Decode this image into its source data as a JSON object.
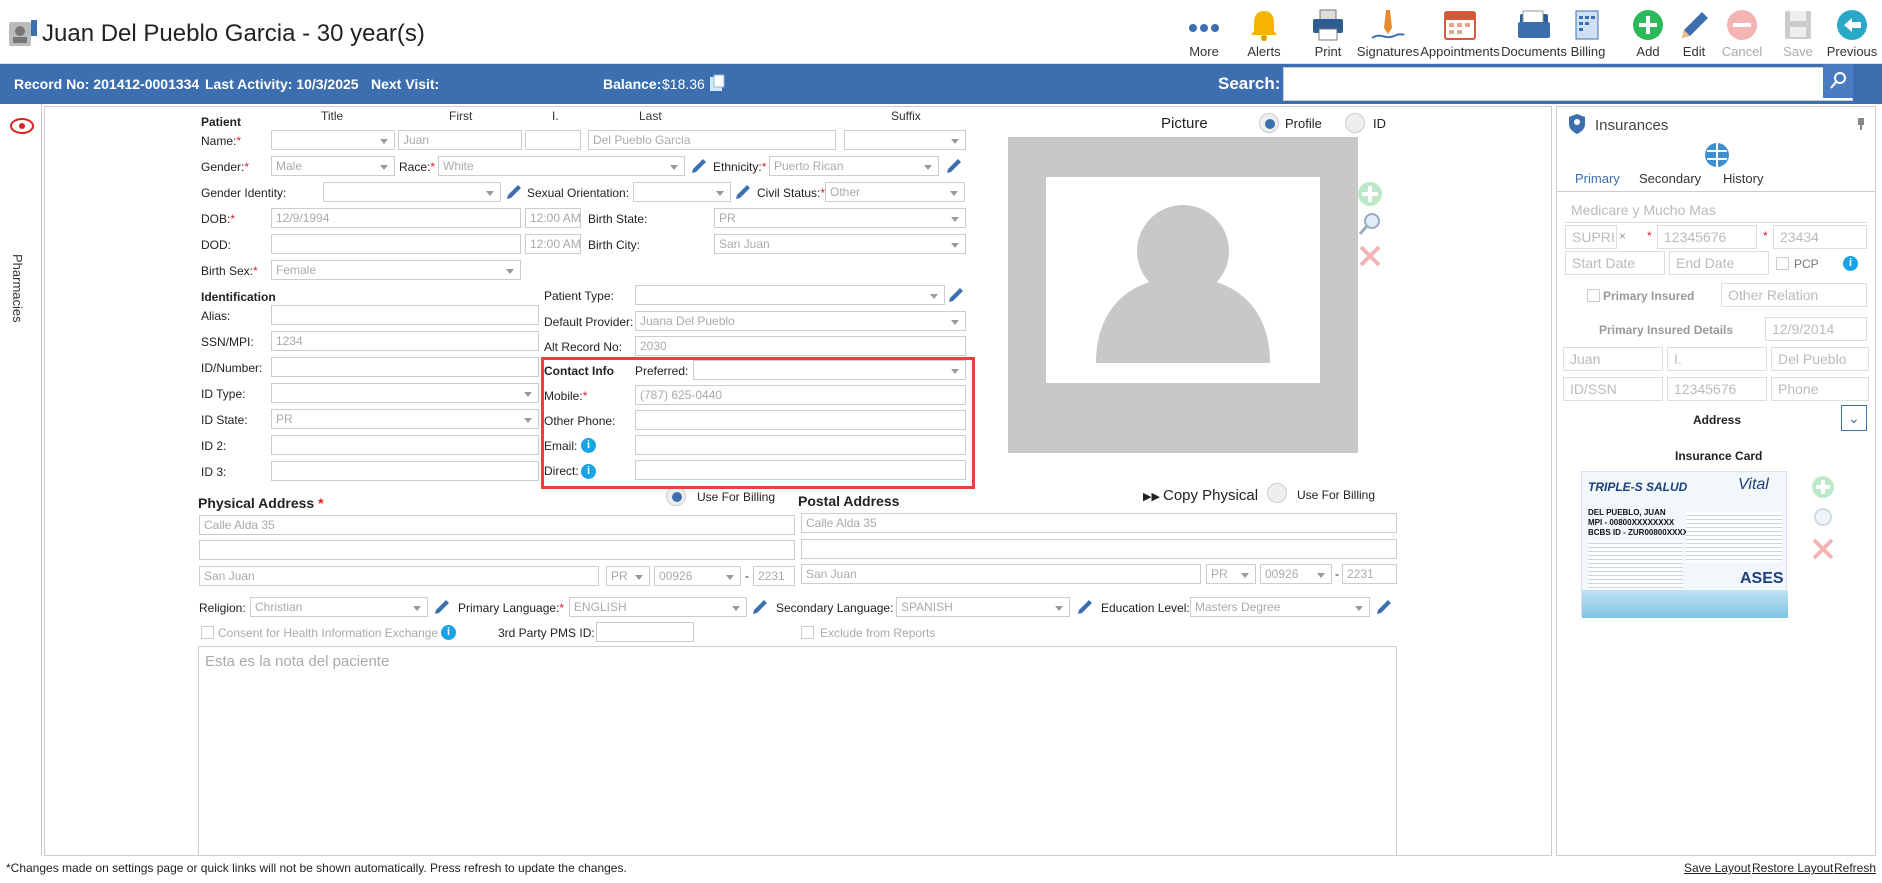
{
  "header": {
    "patient_title": "Juan Del Pueblo Garcia - 30 year(s)"
  },
  "toolbar": {
    "more": "More",
    "alerts": "Alerts",
    "print": "Print",
    "signatures": "Signatures",
    "appointments": "Appointments",
    "documents": "Documents",
    "billing": "Billing",
    "add": "Add",
    "edit": "Edit",
    "cancel": "Cancel",
    "save": "Save",
    "previous": "Previous"
  },
  "bluebar": {
    "record": "Record No: 201412-0001334",
    "last_activity": "Last Activity: 10/3/2025",
    "next_visit": "Next Visit:",
    "balance_label": "Balance:",
    "balance_value": "$18.36",
    "search_label": "Search:",
    "search_clear": "×"
  },
  "sidebar": {
    "pharmacies": "Pharmacies"
  },
  "patient": {
    "section": "Patient",
    "col_title": "Title",
    "col_first": "First",
    "col_i": "I.",
    "col_last": "Last",
    "col_suffix": "Suffix",
    "name_label": "Name:",
    "first": "Juan",
    "last": "Del Pueblo Garcia",
    "gender_label": "Gender:",
    "gender": "Male",
    "race_label": "Race:",
    "race": "White",
    "ethnicity_label": "Ethnicity:",
    "ethnicity": "Puerto Rican",
    "gender_identity_label": "Gender Identity:",
    "sexual_orientation_label": "Sexual Orientation:",
    "civil_status_label": "Civil Status:",
    "civil_status": "Other",
    "dob_label": "DOB:",
    "dob": "12/9/1994",
    "dob_time": "12:00 AM",
    "birth_state_label": "Birth State:",
    "birth_state": "PR",
    "dod_label": "DOD:",
    "dod_time": "12:00 AM",
    "birth_city_label": "Birth City:",
    "birth_city": "San Juan",
    "birth_sex_label": "Birth Sex:",
    "birth_sex": "Female"
  },
  "identification": {
    "section": "Identification",
    "alias_label": "Alias:",
    "ssn_label": "SSN/MPI:",
    "ssn": "1234",
    "id_number_label": "ID/Number:",
    "id_type_label": "ID Type:",
    "id_state_label": "ID State:",
    "id_state": "PR",
    "id2_label": "ID 2:",
    "id3_label": "ID 3:",
    "patient_type_label": "Patient Type:",
    "default_provider_label": "Default Provider:",
    "default_provider": "Juana Del Pueblo",
    "alt_record_label": "Alt Record No:",
    "alt_record": "2030"
  },
  "contact": {
    "section": "Contact Info",
    "preferred_label": "Preferred:",
    "mobile_label": "Mobile:",
    "mobile": "(787) 625-0440",
    "other_phone_label": "Other Phone:",
    "email_label": "Email:",
    "direct_label": "Direct:"
  },
  "picture": {
    "label": "Picture",
    "profile": "Profile",
    "id": "ID"
  },
  "physical": {
    "title": "Physical Address",
    "use_billing": "Use For Billing",
    "addr1": "Calle Alda 35",
    "city": "San Juan",
    "state": "PR",
    "zip": "00926",
    "zip4": "2231"
  },
  "postal": {
    "title": "Postal Address",
    "copy": "Copy Physical",
    "use_billing": "Use For Billing",
    "addr1": "Calle Alda 35",
    "city": "San Juan",
    "state": "PR",
    "zip": "00926",
    "zip4": "2231"
  },
  "misc": {
    "religion_label": "Religion:",
    "religion": "Christian",
    "primary_lang_label": "Primary Language:",
    "primary_lang": "ENGLISH",
    "secondary_lang_label": "Secondary Language:",
    "secondary_lang": "SPANISH",
    "education_label": "Education Level:",
    "education": "Masters Degree",
    "consent": "Consent for Health Information Exchange",
    "pms_label": "3rd Party PMS ID:",
    "exclude": "Exclude from Reports"
  },
  "notes": {
    "text": "Esta es la nota del paciente"
  },
  "insurance": {
    "title": "Insurances",
    "tab_primary": "Primary",
    "tab_secondary": "Secondary",
    "tab_history": "History",
    "plan": "Medicare y Mucho Mas",
    "code": "SUPRI",
    "member": "12345676",
    "group": "23434",
    "start": "Start Date",
    "end": "End Date",
    "pcp": "PCP",
    "primary_insured": "Primary Insured",
    "other_relation": "Other Relation",
    "details": "Primary Insured Details",
    "details_date": "12/9/2014",
    "first": "Juan",
    "initial": "I.",
    "last": "Del Pueblo",
    "id_ssn": "ID/SSN",
    "ssn_val": "12345676",
    "phone": "Phone",
    "address": "Address",
    "card": "Insurance Card"
  },
  "card": {
    "brand": "TRIPLE-S SALUD",
    "vital": "Vital",
    "name": "DEL PUEBLO, JUAN",
    "mpi": "MPI - 00800XXXXXXXX",
    "bcbs": "BCBS ID - ZUR00800XXXXXXXX",
    "ases": "ASES"
  },
  "footer": {
    "note": "*Changes made on settings page or quick links will not be shown automatically. Press refresh to update the changes.",
    "save_layout": "Save Layout",
    "restore_layout": "Restore Layout",
    "refresh": "Refresh"
  }
}
